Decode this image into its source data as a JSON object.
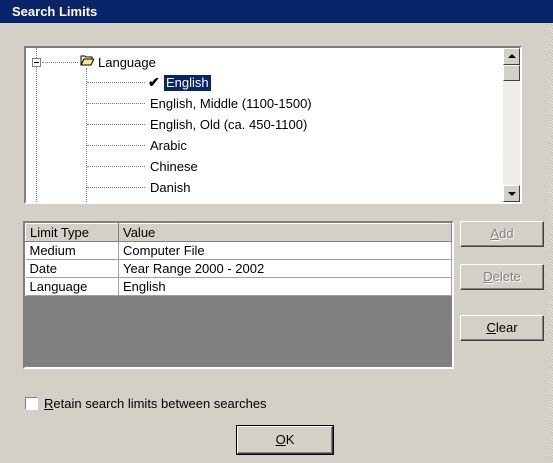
{
  "window": {
    "title": "Search Limits"
  },
  "tree": {
    "root_label": "Language",
    "items": [
      {
        "label": "English",
        "selected": true,
        "checked": true
      },
      {
        "label": "English, Middle (1100-1500)"
      },
      {
        "label": "English, Old (ca. 450-1100)"
      },
      {
        "label": "Arabic"
      },
      {
        "label": "Chinese"
      },
      {
        "label": "Danish"
      }
    ]
  },
  "limits_table": {
    "columns": [
      "Limit Type",
      "Value"
    ],
    "rows": [
      {
        "type": "Medium",
        "value": "Computer File"
      },
      {
        "type": "Date",
        "value": "Year Range 2000 - 2002"
      },
      {
        "type": "Language",
        "value": "English"
      }
    ]
  },
  "buttons": {
    "add": {
      "pre": "",
      "key": "A",
      "post": "dd",
      "enabled": false
    },
    "delete": {
      "pre": "",
      "key": "D",
      "post": "elete",
      "enabled": false
    },
    "clear": {
      "pre": "",
      "key": "C",
      "post": "lear",
      "enabled": true
    },
    "ok": {
      "pre": "",
      "key": "O",
      "post": "K",
      "enabled": true
    }
  },
  "retain_checkbox": {
    "pre": "",
    "key": "R",
    "post": "etain search limits between searches",
    "checked": false
  },
  "icons": {
    "folder": "open-folder-icon",
    "check": "checkmark-icon",
    "expander": "collapse-icon"
  },
  "colors": {
    "selection": "#0a246a",
    "dialog": "#d4d0c8",
    "grid_empty": "#808080"
  }
}
